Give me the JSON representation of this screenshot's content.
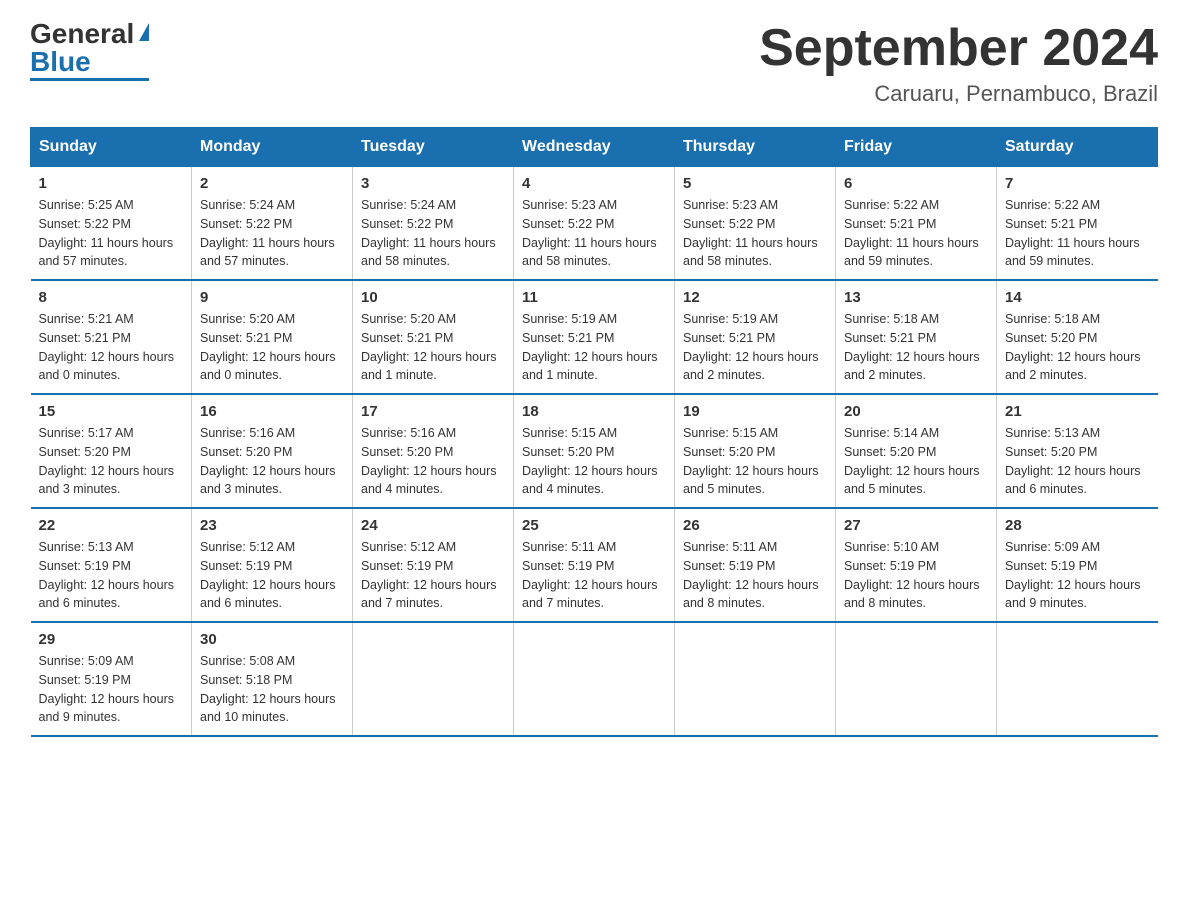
{
  "logo": {
    "general": "General",
    "blue": "Blue"
  },
  "title": "September 2024",
  "location": "Caruaru, Pernambuco, Brazil",
  "weekdays": [
    "Sunday",
    "Monday",
    "Tuesday",
    "Wednesday",
    "Thursday",
    "Friday",
    "Saturday"
  ],
  "weeks": [
    [
      {
        "day": "1",
        "sunrise": "5:25 AM",
        "sunset": "5:22 PM",
        "daylight": "11 hours and 57 minutes."
      },
      {
        "day": "2",
        "sunrise": "5:24 AM",
        "sunset": "5:22 PM",
        "daylight": "11 hours and 57 minutes."
      },
      {
        "day": "3",
        "sunrise": "5:24 AM",
        "sunset": "5:22 PM",
        "daylight": "11 hours and 58 minutes."
      },
      {
        "day": "4",
        "sunrise": "5:23 AM",
        "sunset": "5:22 PM",
        "daylight": "11 hours and 58 minutes."
      },
      {
        "day": "5",
        "sunrise": "5:23 AM",
        "sunset": "5:22 PM",
        "daylight": "11 hours and 58 minutes."
      },
      {
        "day": "6",
        "sunrise": "5:22 AM",
        "sunset": "5:21 PM",
        "daylight": "11 hours and 59 minutes."
      },
      {
        "day": "7",
        "sunrise": "5:22 AM",
        "sunset": "5:21 PM",
        "daylight": "11 hours and 59 minutes."
      }
    ],
    [
      {
        "day": "8",
        "sunrise": "5:21 AM",
        "sunset": "5:21 PM",
        "daylight": "12 hours and 0 minutes."
      },
      {
        "day": "9",
        "sunrise": "5:20 AM",
        "sunset": "5:21 PM",
        "daylight": "12 hours and 0 minutes."
      },
      {
        "day": "10",
        "sunrise": "5:20 AM",
        "sunset": "5:21 PM",
        "daylight": "12 hours and 1 minute."
      },
      {
        "day": "11",
        "sunrise": "5:19 AM",
        "sunset": "5:21 PM",
        "daylight": "12 hours and 1 minute."
      },
      {
        "day": "12",
        "sunrise": "5:19 AM",
        "sunset": "5:21 PM",
        "daylight": "12 hours and 2 minutes."
      },
      {
        "day": "13",
        "sunrise": "5:18 AM",
        "sunset": "5:21 PM",
        "daylight": "12 hours and 2 minutes."
      },
      {
        "day": "14",
        "sunrise": "5:18 AM",
        "sunset": "5:20 PM",
        "daylight": "12 hours and 2 minutes."
      }
    ],
    [
      {
        "day": "15",
        "sunrise": "5:17 AM",
        "sunset": "5:20 PM",
        "daylight": "12 hours and 3 minutes."
      },
      {
        "day": "16",
        "sunrise": "5:16 AM",
        "sunset": "5:20 PM",
        "daylight": "12 hours and 3 minutes."
      },
      {
        "day": "17",
        "sunrise": "5:16 AM",
        "sunset": "5:20 PM",
        "daylight": "12 hours and 4 minutes."
      },
      {
        "day": "18",
        "sunrise": "5:15 AM",
        "sunset": "5:20 PM",
        "daylight": "12 hours and 4 minutes."
      },
      {
        "day": "19",
        "sunrise": "5:15 AM",
        "sunset": "5:20 PM",
        "daylight": "12 hours and 5 minutes."
      },
      {
        "day": "20",
        "sunrise": "5:14 AM",
        "sunset": "5:20 PM",
        "daylight": "12 hours and 5 minutes."
      },
      {
        "day": "21",
        "sunrise": "5:13 AM",
        "sunset": "5:20 PM",
        "daylight": "12 hours and 6 minutes."
      }
    ],
    [
      {
        "day": "22",
        "sunrise": "5:13 AM",
        "sunset": "5:19 PM",
        "daylight": "12 hours and 6 minutes."
      },
      {
        "day": "23",
        "sunrise": "5:12 AM",
        "sunset": "5:19 PM",
        "daylight": "12 hours and 6 minutes."
      },
      {
        "day": "24",
        "sunrise": "5:12 AM",
        "sunset": "5:19 PM",
        "daylight": "12 hours and 7 minutes."
      },
      {
        "day": "25",
        "sunrise": "5:11 AM",
        "sunset": "5:19 PM",
        "daylight": "12 hours and 7 minutes."
      },
      {
        "day": "26",
        "sunrise": "5:11 AM",
        "sunset": "5:19 PM",
        "daylight": "12 hours and 8 minutes."
      },
      {
        "day": "27",
        "sunrise": "5:10 AM",
        "sunset": "5:19 PM",
        "daylight": "12 hours and 8 minutes."
      },
      {
        "day": "28",
        "sunrise": "5:09 AM",
        "sunset": "5:19 PM",
        "daylight": "12 hours and 9 minutes."
      }
    ],
    [
      {
        "day": "29",
        "sunrise": "5:09 AM",
        "sunset": "5:19 PM",
        "daylight": "12 hours and 9 minutes."
      },
      {
        "day": "30",
        "sunrise": "5:08 AM",
        "sunset": "5:18 PM",
        "daylight": "12 hours and 10 minutes."
      },
      null,
      null,
      null,
      null,
      null
    ]
  ]
}
